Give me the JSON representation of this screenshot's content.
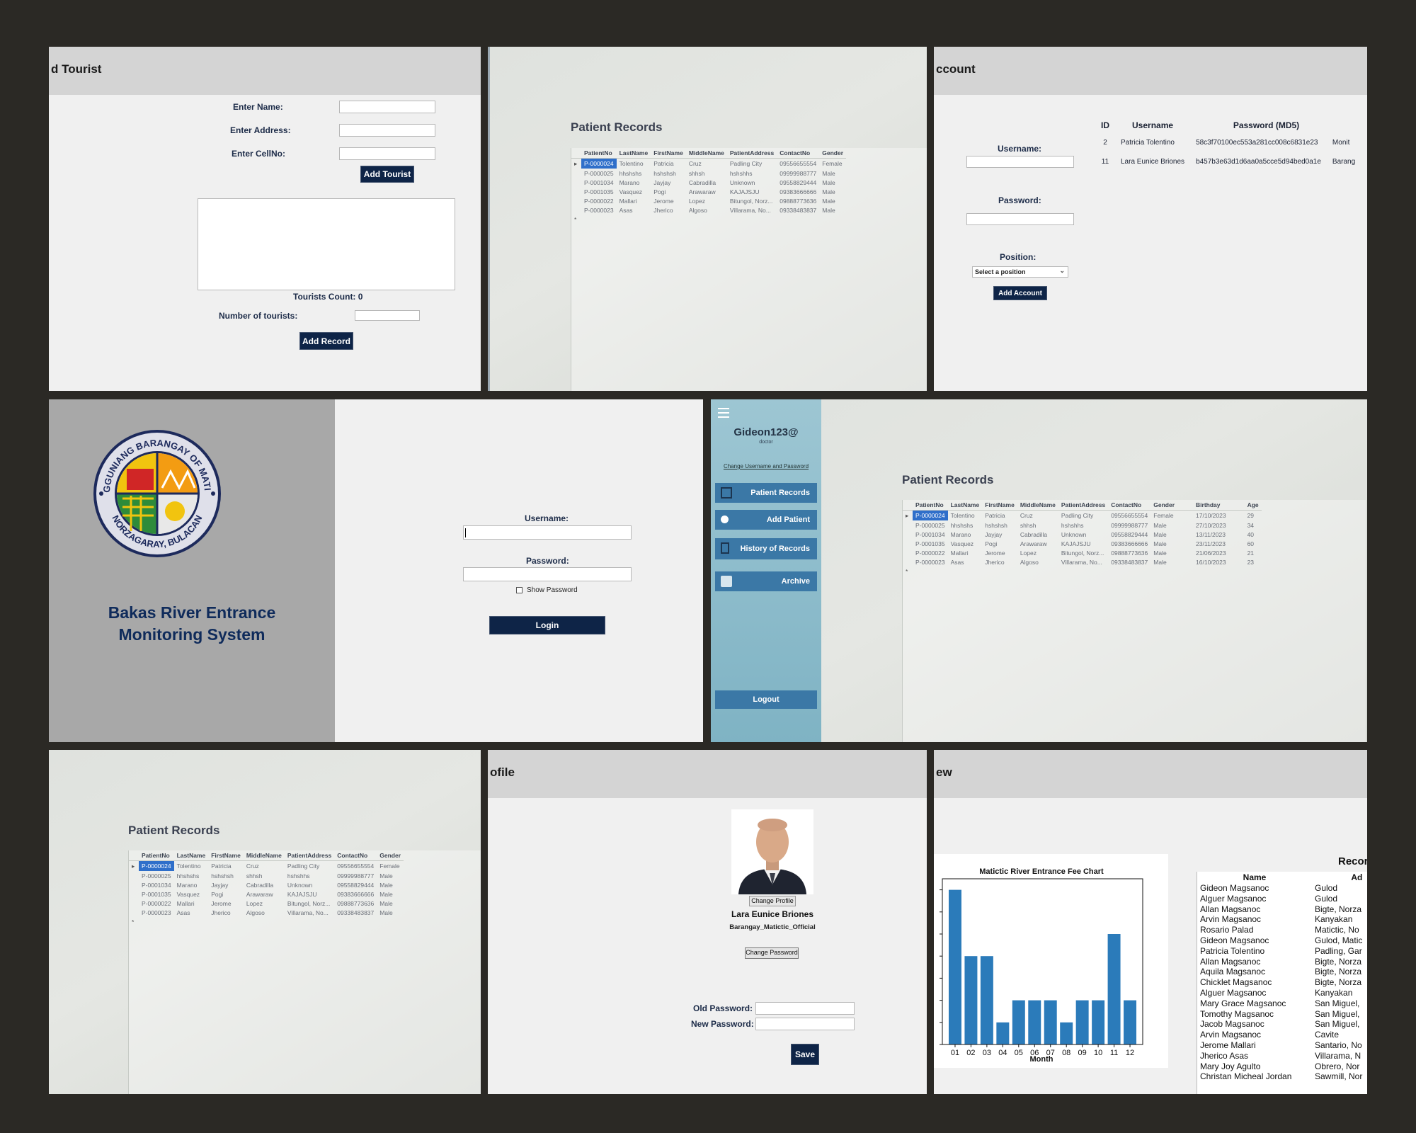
{
  "add_tourist": {
    "title": "d Tourist",
    "name_label": "Enter Name:",
    "address_label": "Enter Address:",
    "cell_label": "Enter CellNo:",
    "add_tourist_button": "Add Tourist",
    "tourists_count": "Tourists Count: 0",
    "number_label": "Number of tourists:",
    "add_record_button": "Add Record"
  },
  "patient_records": {
    "title": "Patient Records",
    "columns": [
      "PatientNo",
      "LastName",
      "FirstName",
      "MiddleName",
      "PatientAddress",
      "ContactNo",
      "Gender"
    ],
    "extra_columns": [
      "Birthday",
      "Age"
    ],
    "rows": [
      {
        "no": "P-0000024",
        "last": "Tolentino",
        "first": "Patricia",
        "middle": "Cruz",
        "address": "Padling City",
        "contact": "09556655554",
        "gender": "Female",
        "birthday": "17/10/2023",
        "age": "29"
      },
      {
        "no": "P-0000025",
        "last": "hhshshs",
        "first": "hshshsh",
        "middle": "shhsh",
        "address": "hshshhs",
        "contact": "09999988777",
        "gender": "Male",
        "birthday": "27/10/2023",
        "age": "34"
      },
      {
        "no": "P-0001034",
        "last": "Marano",
        "first": "Jayjay",
        "middle": "Cabradilla",
        "address": "Unknown",
        "contact": "09558829444",
        "gender": "Male",
        "birthday": "13/11/2023",
        "age": "40"
      },
      {
        "no": "P-0001035",
        "last": "Vasquez",
        "first": "Pogi",
        "middle": "Arawaraw",
        "address": "KAJAJSJU",
        "contact": "09383666666",
        "gender": "Male",
        "birthday": "23/11/2023",
        "age": "60"
      },
      {
        "no": "P-0000022",
        "last": "Mallari",
        "first": "Jerome",
        "middle": "Lopez",
        "address": "Bitungol, Norz...",
        "contact": "09888773636",
        "gender": "Male",
        "birthday": "21/06/2023",
        "age": "21"
      },
      {
        "no": "P-0000023",
        "last": "Asas",
        "first": "Jherico",
        "middle": "Algoso",
        "address": "Villarama, No...",
        "contact": "09338483837",
        "gender": "Male",
        "birthday": "16/10/2023",
        "age": "23"
      }
    ]
  },
  "add_account": {
    "title": "ccount",
    "username_label": "Username:",
    "password_label": "Password:",
    "position_label": "Position:",
    "position_placeholder": "Select a position",
    "add_account_button": "Add Account",
    "columns": [
      "ID",
      "Username",
      "Password (MD5)"
    ],
    "rows": [
      {
        "id": "2",
        "username": "Patricia Tolentino",
        "password": "58c3f70100ec553a281cc008c6831e23",
        "role": "Monit"
      },
      {
        "id": "11",
        "username": "Lara Eunice Briones",
        "password": "b457b3e63d1d6aa0a5cce5d94bed0a1e",
        "role": "Barang"
      }
    ]
  },
  "login": {
    "seal_top": "SANGGUNIANG BARANGAY OF MATICTIC",
    "seal_bottom": "NORZAGARAY, BULACAN",
    "system_title_line1": "Bakas River Entrance",
    "system_title_line2": "Monitoring System",
    "username_label": "Username:",
    "password_label": "Password:",
    "show_password": "Show Password",
    "login_button": "Login"
  },
  "dashboard": {
    "user": "Gideon123@",
    "role": "doctor",
    "change_link": "Change Username and Password",
    "menu": [
      "Patient Records",
      "Add Patient",
      "History of Records",
      "Archive"
    ],
    "logout": "Logout"
  },
  "profile": {
    "title": "ofile",
    "change_profile_button": "Change Profile",
    "name": "Lara Eunice Briones",
    "username": "Barangay_Matictic_Official",
    "change_password_button": "Change Password",
    "old_password_label": "Old Password:",
    "new_password_label": "New Password:",
    "save_button": "Save"
  },
  "overview": {
    "title": "ew",
    "records_title": "Records",
    "records_columns": [
      "Name",
      "Ad"
    ],
    "records": [
      {
        "name": "Gideon Magsanoc",
        "address": "Gulod"
      },
      {
        "name": "Alguer Magsanoc",
        "address": "Gulod"
      },
      {
        "name": "Allan Magsanoc",
        "address": "Bigte, Norza"
      },
      {
        "name": "Arvin Magsanoc",
        "address": "Kanyakan"
      },
      {
        "name": "Rosario Palad",
        "address": "Matictic, No"
      },
      {
        "name": "Gideon Magsanoc",
        "address": "Gulod, Matic"
      },
      {
        "name": "Patricia Tolentino",
        "address": "Padling, Gar"
      },
      {
        "name": "Allan Magsanoc",
        "address": "Bigte, Norza"
      },
      {
        "name": "Aquila Magsanoc",
        "address": "Bigte, Norza"
      },
      {
        "name": "Chicklet Magsanoc",
        "address": "Bigte, Norza"
      },
      {
        "name": "Alguer Magsanoc",
        "address": "Kanyakan"
      },
      {
        "name": "Mary Grace Magsanoc",
        "address": "San Miguel,"
      },
      {
        "name": "Tomothy Magsanoc",
        "address": "San Miguel,"
      },
      {
        "name": "Jacob Magsanoc",
        "address": "San Miguel,"
      },
      {
        "name": "Arvin Magsanoc",
        "address": "Cavite"
      },
      {
        "name": "Jerome Mallari",
        "address": "Santario, No"
      },
      {
        "name": "Jherico Asas",
        "address": "Villarama, N"
      },
      {
        "name": "Mary Joy Agulto",
        "address": "Obrero, Nor"
      },
      {
        "name": "Christan Micheal Jordan",
        "address": "Sawmill, Nor"
      }
    ]
  },
  "chart_data": {
    "type": "bar",
    "title": "Matictic River Entrance Fee Chart",
    "xlabel": "Month",
    "ylabel": "",
    "categories": [
      "01",
      "02",
      "03",
      "04",
      "05",
      "06",
      "07",
      "08",
      "09",
      "10",
      "11",
      "12"
    ],
    "values": [
      7,
      4,
      4,
      1,
      2,
      2,
      2,
      1,
      2,
      2,
      5,
      2
    ],
    "ylim": [
      0,
      7.5
    ],
    "color": "#2b7bba"
  }
}
